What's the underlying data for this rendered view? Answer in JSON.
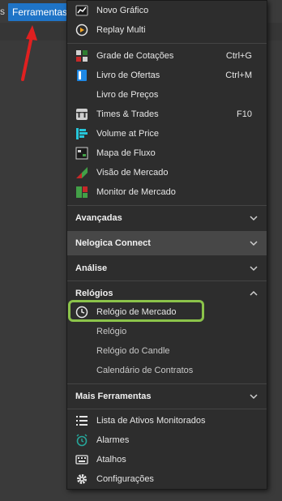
{
  "menubar": {
    "prev_fragment": "s",
    "active_menu": "Ferramentas"
  },
  "toolbar": {
    "fragment": "s"
  },
  "menu": {
    "group1": [
      {
        "label": "Novo Gráfico",
        "icon": "new-chart-icon"
      },
      {
        "label": "Replay Multi",
        "icon": "replay-icon"
      }
    ],
    "group2": [
      {
        "label": "Grade de Cotações",
        "shortcut": "Ctrl+G",
        "icon": "quote-grid-icon"
      },
      {
        "label": "Livro de Ofertas",
        "shortcut": "Ctrl+M",
        "icon": "order-book-icon"
      },
      {
        "label": "Livro de Preços",
        "shortcut": "",
        "icon": ""
      },
      {
        "label": "Times & Trades",
        "shortcut": "F10",
        "icon": "times-trades-icon"
      },
      {
        "label": "Volume at Price",
        "shortcut": "",
        "icon": "volume-price-icon"
      },
      {
        "label": "Mapa de Fluxo",
        "shortcut": "",
        "icon": "flow-map-icon"
      },
      {
        "label": "Visão de Mercado",
        "shortcut": "",
        "icon": "market-view-icon"
      },
      {
        "label": "Monitor de Mercado",
        "shortcut": "",
        "icon": "market-monitor-icon"
      }
    ],
    "sections": {
      "avancadas": "Avançadas",
      "nelogica": "Nelogica Connect",
      "analise": "Análise",
      "relogios": "Relógios",
      "mais": "Mais Ferramentas"
    },
    "relogios_items": [
      {
        "label": "Relógio de Mercado",
        "icon": "clock-icon",
        "highlighted": true
      },
      {
        "label": "Relógio"
      },
      {
        "label": "Relógio do Candle"
      },
      {
        "label": "Calendário de Contratos"
      }
    ],
    "mais_items": [
      {
        "label": "Lista de Ativos Monitorados",
        "icon": "list-icon"
      },
      {
        "label": "Alarmes",
        "icon": "alarm-icon"
      },
      {
        "label": "Atalhos",
        "icon": "keyboard-icon"
      },
      {
        "label": "Configurações",
        "icon": "gear-icon"
      }
    ]
  },
  "colors": {
    "accent": "#1f74c7",
    "highlight": "#8bc34a",
    "arrow": "#e02020"
  }
}
